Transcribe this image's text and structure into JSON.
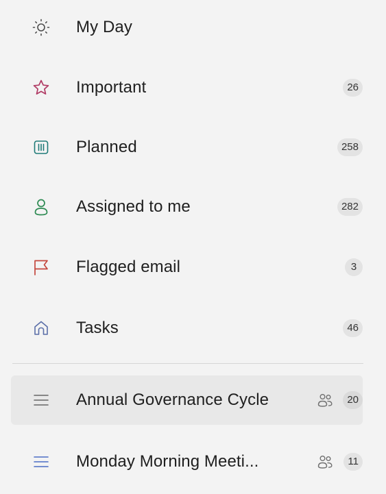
{
  "colors": {
    "sun": "#4d4d4d",
    "star": "#b03a64",
    "planned": "#1e7a77",
    "assigned": "#2d8a52",
    "flag": "#c4473d",
    "tasks": "#5a6ea8",
    "list": "#4a6cc4",
    "selected_indicator": "#1a63c7"
  },
  "smart_lists": [
    {
      "label": "My Day",
      "icon": "sun-icon",
      "count": ""
    },
    {
      "label": "Important",
      "icon": "star-icon",
      "count": "26"
    },
    {
      "label": "Planned",
      "icon": "calendar-icon",
      "count": "258"
    },
    {
      "label": "Assigned to me",
      "icon": "person-icon",
      "count": "282"
    },
    {
      "label": "Flagged email",
      "icon": "flag-icon",
      "count": "3"
    },
    {
      "label": "Tasks",
      "icon": "home-icon",
      "count": "46"
    }
  ],
  "user_lists": [
    {
      "label": "Annual Governance Cycle",
      "icon": "list-icon",
      "shared_icon": "people-icon",
      "count": "20",
      "selected": true
    },
    {
      "label": "Monday Morning Meeti...",
      "icon": "list-icon",
      "shared_icon": "people-icon",
      "count": "11",
      "selected": false
    }
  ]
}
